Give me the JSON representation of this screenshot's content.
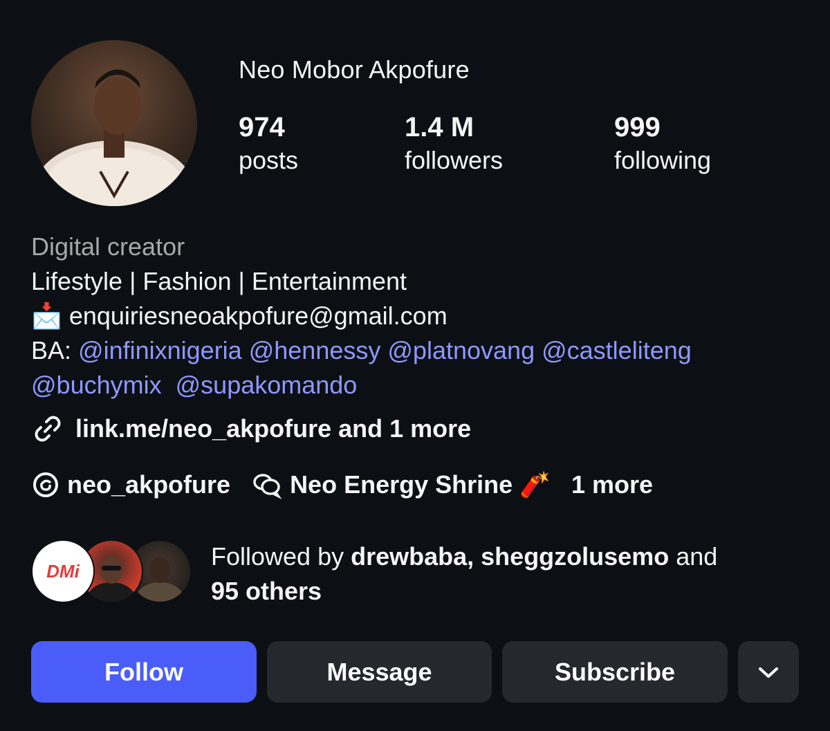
{
  "profile": {
    "name": "Neo Mobor Akpofure",
    "avatar_icon": "profile-photo"
  },
  "stats": {
    "posts": {
      "value": "974",
      "label": "posts"
    },
    "followers": {
      "value": "1.4 M",
      "label": "followers"
    },
    "following": {
      "value": "999",
      "label": "following"
    }
  },
  "bio": {
    "category": "Digital creator",
    "line1": "Lifestyle | Fashion | Entertainment",
    "email_icon": "📩",
    "email": "enquiriesneoakpofure@gmail.com",
    "ba_prefix": "BA:",
    "mentions_line1": [
      "@infinixnigeria",
      "@hennessy",
      "@platnovang",
      "@castleliteng"
    ],
    "mentions_line2": [
      "@buchymix",
      "@supakomando"
    ]
  },
  "link": {
    "icon": "link-icon",
    "text": "link.me/neo_akpofure and 1 more"
  },
  "social": {
    "threads_icon": "threads-icon",
    "threads_handle": "neo_akpofure",
    "channel_icon": "broadcast-channel-icon",
    "channel_name": "Neo Energy Shrine 🧨",
    "more": "1 more"
  },
  "followed_by": {
    "prefix": "Followed by ",
    "names": "drewbaba, sheggzolusemo",
    "and": " and",
    "others": "95 others",
    "avatar1_text": "DMi"
  },
  "buttons": {
    "follow": "Follow",
    "message": "Message",
    "subscribe": "Subscribe",
    "more_icon": "chevron-down-icon"
  },
  "colors": {
    "background": "#0c1014",
    "accent": "#4a5df9",
    "mention": "#8f98ff",
    "secondary_button": "#25292e"
  }
}
